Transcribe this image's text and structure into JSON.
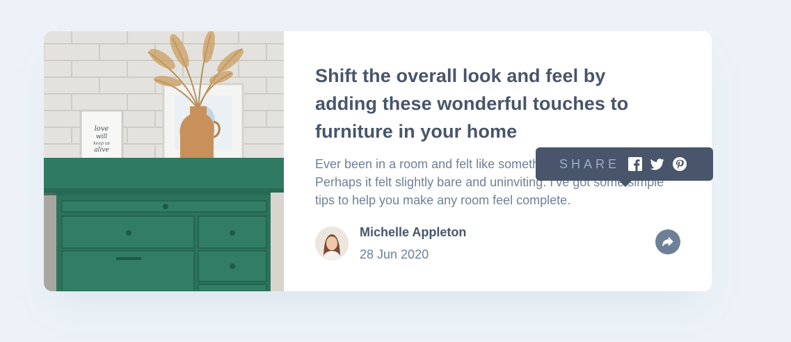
{
  "article": {
    "title": "Shift the overall look and feel by adding these wonderful touches to furniture in your home",
    "excerpt": "Ever been in a room and felt like something was missing? Perhaps it felt slightly bare and uninviting. I’ve got some simple tips to help you make any room feel complete."
  },
  "author": {
    "name": "Michelle Appleton",
    "date": "28 Jun 2020"
  },
  "share": {
    "label": "SHARE",
    "icons": [
      "facebook-icon",
      "twitter-icon",
      "pinterest-icon"
    ],
    "button_icon": "share-arrow-icon"
  },
  "image": {
    "frame_text": [
      "love",
      "will",
      "keep us",
      "alive"
    ]
  },
  "colors": {
    "background": "#ecf2f8",
    "card": "#ffffff",
    "heading": "#48556a",
    "body_text": "#6e8098",
    "tooltip": "#48556a",
    "tooltip_label": "#9dafc2",
    "drawer": "#2f7a62"
  }
}
